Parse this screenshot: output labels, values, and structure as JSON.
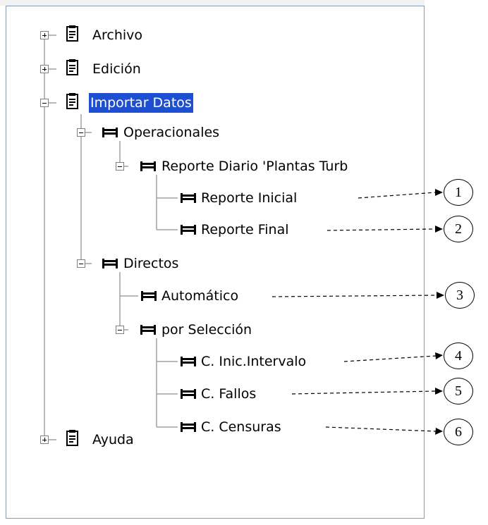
{
  "tree": {
    "archivo": "Archivo",
    "edicion": "Edición",
    "importar_datos": "Importar Datos",
    "operacionales": "Operacionales",
    "reporte_diario": "Reporte Diario 'Plantas Turb",
    "reporte_inicial": "Reporte Inicial",
    "reporte_final": "Reporte Final",
    "directos": "Directos",
    "automatico": "Automático",
    "por_seleccion": "por Selección",
    "c_inic_intervalo": "C. Inic.Intervalo",
    "c_fallos": "C. Fallos",
    "c_censuras": "C. Censuras",
    "ayuda": "Ayuda"
  },
  "callouts": [
    "1",
    "2",
    "3",
    "4",
    "5",
    "6"
  ],
  "colors": {
    "selection": "#1f4fd1",
    "border": "#7f9db9",
    "tree_lines": "#a0a0a0"
  }
}
